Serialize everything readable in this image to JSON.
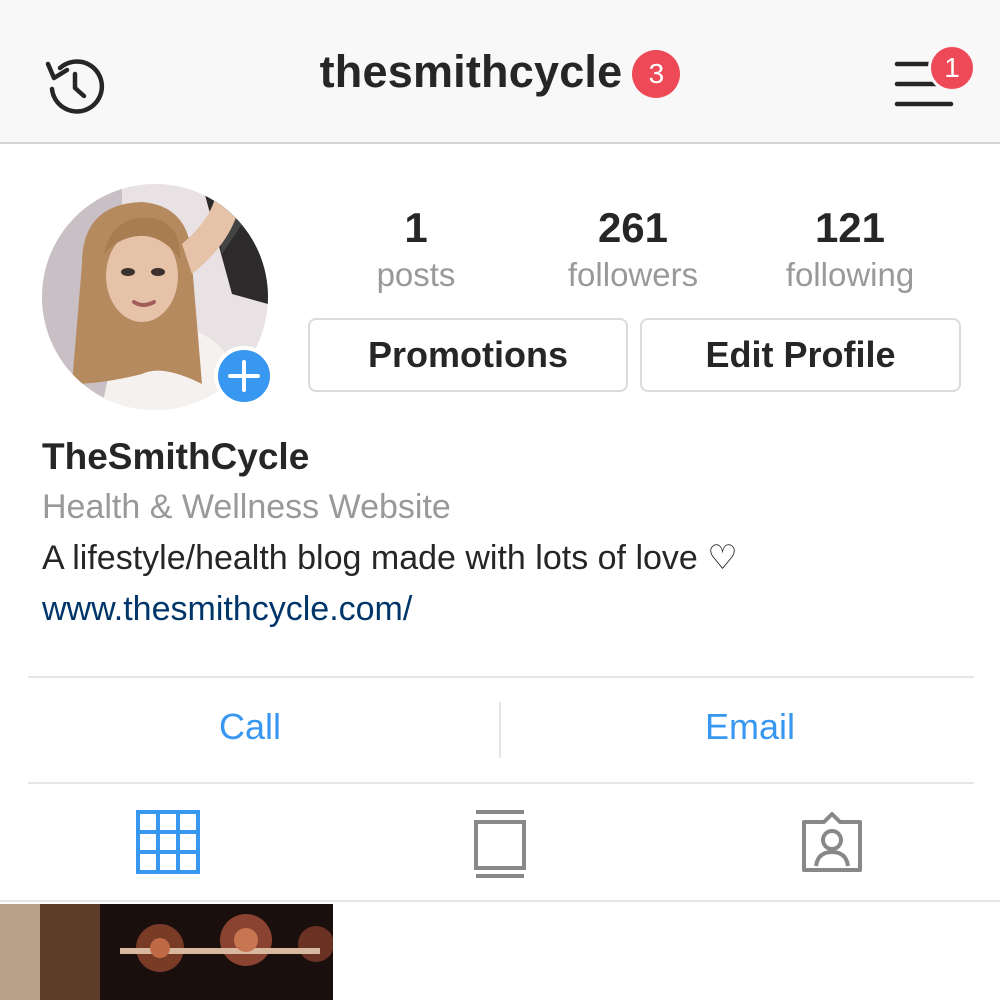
{
  "header": {
    "username": "thesmithcycle",
    "username_badge": "3",
    "menu_badge": "1",
    "history_icon": "history-clock-icon",
    "menu_icon": "hamburger-menu-icon"
  },
  "stats": [
    {
      "value": "1",
      "label": "posts"
    },
    {
      "value": "261",
      "label": "followers"
    },
    {
      "value": "121",
      "label": "following"
    }
  ],
  "buttons": {
    "promotions": "Promotions",
    "edit_profile": "Edit Profile"
  },
  "bio": {
    "name": "TheSmithCycle",
    "category": "Health & Wellness Website",
    "text": "A lifestyle/health blog made with lots of love ♡",
    "link": "www.thesmithcycle.com/"
  },
  "contact": {
    "call": "Call",
    "email": "Email"
  },
  "tabs": [
    {
      "icon": "grid-icon",
      "active": true
    },
    {
      "icon": "feed-list-icon",
      "active": false
    },
    {
      "icon": "tagged-photos-icon",
      "active": false
    }
  ],
  "colors": {
    "accent": "#3897f0",
    "badge": "#ed4956",
    "link": "#003569",
    "muted": "#999999"
  }
}
